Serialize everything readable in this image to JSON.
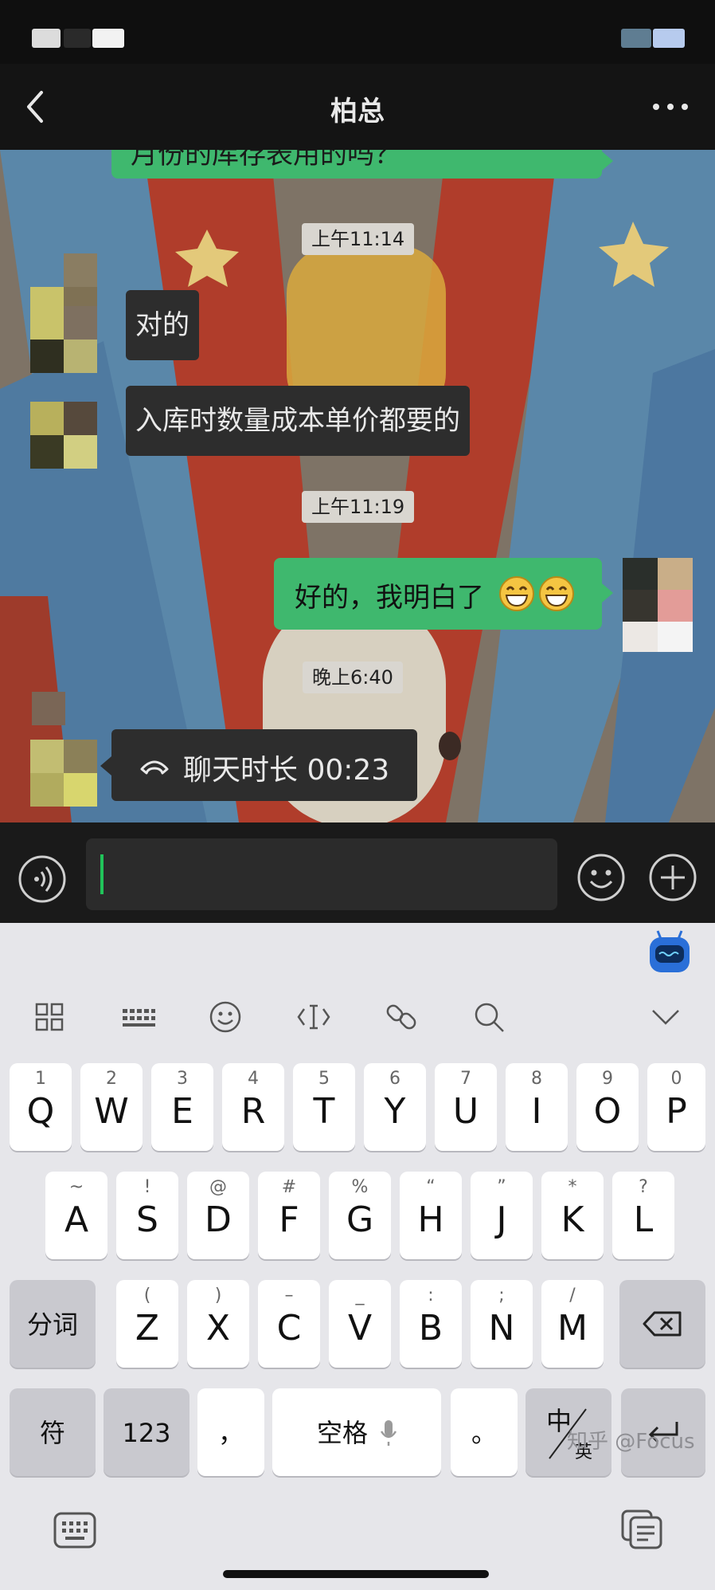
{
  "nav": {
    "title": "柏总"
  },
  "messages": {
    "partial_out": "月份的库存表用的吗？",
    "time1": "上午11:14",
    "in1": "对的",
    "in2": "入库时数量成本单价都要的",
    "time2": "上午11:19",
    "out1": "好的，我明白了",
    "out1_emoji": [
      "grinning-face-with-smiling-eyes",
      "grinning-face-with-smiling-eyes"
    ],
    "time3": "晚上6:40",
    "call_label": "聊天时长 00:23"
  },
  "input": {
    "value": ""
  },
  "keyboard": {
    "row1": [
      {
        "k": "Q",
        "s": "1"
      },
      {
        "k": "W",
        "s": "2"
      },
      {
        "k": "E",
        "s": "3"
      },
      {
        "k": "R",
        "s": "4"
      },
      {
        "k": "T",
        "s": "5"
      },
      {
        "k": "Y",
        "s": "6"
      },
      {
        "k": "U",
        "s": "7"
      },
      {
        "k": "I",
        "s": "8"
      },
      {
        "k": "O",
        "s": "9"
      },
      {
        "k": "P",
        "s": "0"
      }
    ],
    "row2": [
      {
        "k": "A",
        "s": "~"
      },
      {
        "k": "S",
        "s": "!"
      },
      {
        "k": "D",
        "s": "@"
      },
      {
        "k": "F",
        "s": "#"
      },
      {
        "k": "G",
        "s": "%"
      },
      {
        "k": "H",
        "s": "“"
      },
      {
        "k": "J",
        "s": "”"
      },
      {
        "k": "K",
        "s": "*"
      },
      {
        "k": "L",
        "s": "?"
      }
    ],
    "row3": [
      {
        "k": "Z",
        "s": "("
      },
      {
        "k": "X",
        "s": ")"
      },
      {
        "k": "C",
        "s": "–"
      },
      {
        "k": "V",
        "s": "_"
      },
      {
        "k": "B",
        "s": ":"
      },
      {
        "k": "N",
        "s": ";"
      },
      {
        "k": "M",
        "s": "/"
      }
    ],
    "segment_key": "分词",
    "symbol_key": "符",
    "num_key": "123",
    "comma_key": "，",
    "space_key": "空格",
    "period_key": "。",
    "lang_cn": "中",
    "lang_en": "英",
    "toolbar_icons": [
      "grid-icon",
      "keyboard-icon",
      "emoji-icon",
      "cursor-icon",
      "link-icon",
      "search-icon",
      "chevron-down-icon"
    ]
  },
  "watermark": "知乎 @Focus",
  "colors": {
    "green_bubble": "#3fb86e",
    "dark_bubble": "#2d2d2d",
    "caret": "#21c45a"
  }
}
